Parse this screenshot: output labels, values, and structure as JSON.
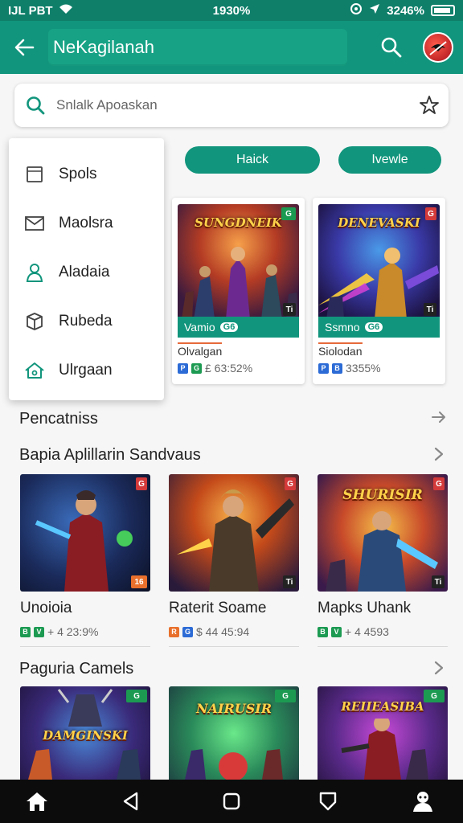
{
  "status_bar": {
    "carrier": "IJL PBT",
    "center_text": "1930%",
    "battery_text": "3246%"
  },
  "app_bar": {
    "title": "NeKagilanah"
  },
  "search": {
    "placeholder": "Snlalk Apoaskan"
  },
  "menu": {
    "items": [
      {
        "label": "Spols",
        "icon": "tablet-icon"
      },
      {
        "label": "Maolsra",
        "icon": "mail-icon"
      },
      {
        "label": "Aladaia",
        "icon": "person-icon"
      },
      {
        "label": "Rubeda",
        "icon": "box-icon"
      },
      {
        "label": "Ulrgaan",
        "icon": "home-icon"
      }
    ]
  },
  "chips": [
    "Haick",
    "Ivewle"
  ],
  "featured": [
    {
      "art_title": "SUNGDNEIK",
      "label": "Vamio",
      "label_badge": "G6",
      "name": "Olvalgan",
      "meta": "£ 63:52%",
      "corner_tag": "G",
      "bottom_tag": "Ti"
    },
    {
      "art_title": "DENEVASKI",
      "label": "Ssmno",
      "label_badge": "G6",
      "name": "Siolodan",
      "meta": "3355%",
      "corner_tag": "G",
      "bottom_tag": "Ti"
    }
  ],
  "sections": [
    {
      "title": "Pencatniss"
    },
    {
      "title": "Bapia Aplillarin Sandvaus",
      "cards": [
        {
          "name": "Unoioia",
          "meta": "+ 4 23:9%",
          "tag": "G",
          "bottom_tag": "16"
        },
        {
          "name": "Raterit Soame",
          "meta": "$ 44 45:94",
          "tag": "G",
          "bottom_tag": "Ti"
        },
        {
          "name": "Mapks Uhank",
          "meta": "+ 4 4593",
          "tag": "G",
          "art_title": "SHURISIR",
          "bottom_tag": "Ti"
        }
      ]
    },
    {
      "title": "Paguria Camels",
      "cards": [
        {
          "art_title": "DAMGINSKI",
          "tag": "G"
        },
        {
          "art_title": "NAIRUSIR",
          "tag": "G"
        },
        {
          "art_title": "REIIEASIBA",
          "tag": "G"
        }
      ]
    }
  ],
  "colors": {
    "primary": "#11957c",
    "primary_dark": "#0f7f6a",
    "accent_orange": "#e66a3a"
  }
}
